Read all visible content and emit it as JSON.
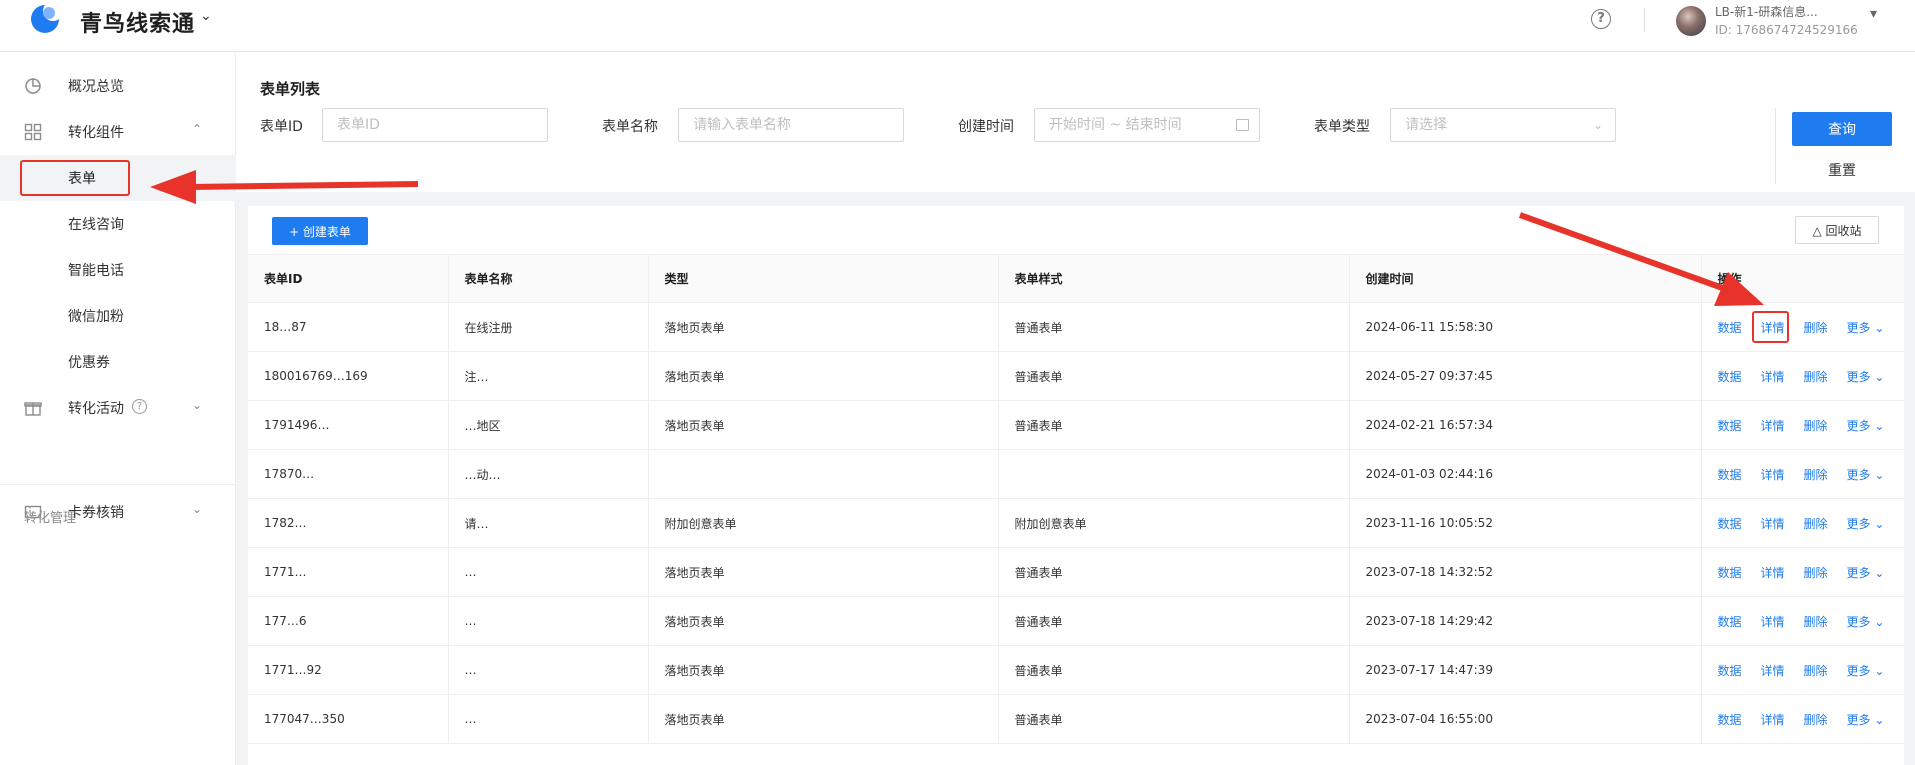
{
  "header": {
    "brand": "青鸟线索通",
    "user_name": "LB-新1-研森信息...",
    "user_id": "ID: 1768674724529166",
    "help_glyph": "?"
  },
  "sidebar": {
    "items": [
      {
        "label": "概况总览",
        "icon": "pie-chart-icon"
      },
      {
        "label": "转化组件",
        "icon": "grid-icon"
      },
      {
        "label": "表单"
      },
      {
        "label": "在线咨询"
      },
      {
        "label": "智能电话"
      },
      {
        "label": "微信加粉"
      },
      {
        "label": "优惠券"
      },
      {
        "label": "转化活动",
        "icon": "gift-icon"
      },
      {
        "label": "卡券核销",
        "icon": "ticket-icon"
      }
    ],
    "group_label": "转化管理",
    "active_item": "表单"
  },
  "filter": {
    "title": "表单列表",
    "form_id_label": "表单ID",
    "form_id_placeholder": "表单ID",
    "form_name_label": "表单名称",
    "form_name_placeholder": "请输入表单名称",
    "created_label": "创建时间",
    "created_placeholder": "开始时间 ~ 结束时间",
    "type_label": "表单类型",
    "type_placeholder": "请选择",
    "query_label": "查询",
    "reset_label": "重置"
  },
  "toolbar": {
    "create_label": "+ 创建表单",
    "recycle_label": "回收站"
  },
  "table": {
    "columns": [
      "表单ID",
      "表单名称",
      "类型",
      "表单样式",
      "创建时间",
      "操作"
    ],
    "actions": {
      "data": "数据",
      "detail": "详情",
      "delete": "删除",
      "more": "更多"
    },
    "rows": [
      {
        "id": "18…87",
        "name": "在线注册",
        "type": "落地页表单",
        "style": "普通表单",
        "created": "2024-06-11 15:58:30"
      },
      {
        "id": "180016769…169",
        "name": "注…",
        "type": "落地页表单",
        "style": "普通表单",
        "created": "2024-05-27 09:37:45"
      },
      {
        "id": "1791496…",
        "name": "…地区",
        "type": "落地页表单",
        "style": "普通表单",
        "created": "2024-02-21 16:57:34"
      },
      {
        "id": "17870…",
        "name": "…动…",
        "type": "",
        "style": "",
        "created": "2024-01-03 02:44:16"
      },
      {
        "id": "1782…",
        "name": "请…",
        "type": "附加创意表单",
        "style": "附加创意表单",
        "created": "2023-11-16 10:05:52"
      },
      {
        "id": "1771…",
        "name": "…",
        "type": "落地页表单",
        "style": "普通表单",
        "created": "2023-07-18 14:32:52"
      },
      {
        "id": "177…6",
        "name": "…",
        "type": "落地页表单",
        "style": "普通表单",
        "created": "2023-07-18 14:29:42"
      },
      {
        "id": "1771…92",
        "name": "…",
        "type": "落地页表单",
        "style": "普通表单",
        "created": "2023-07-17 14:47:39"
      },
      {
        "id": "177047…350",
        "name": "…",
        "type": "落地页表单",
        "style": "普通表单",
        "created": "2023-07-04 16:55:00"
      }
    ]
  },
  "colors": {
    "accent": "#1e7cf0",
    "annotation": "#e8332a"
  }
}
